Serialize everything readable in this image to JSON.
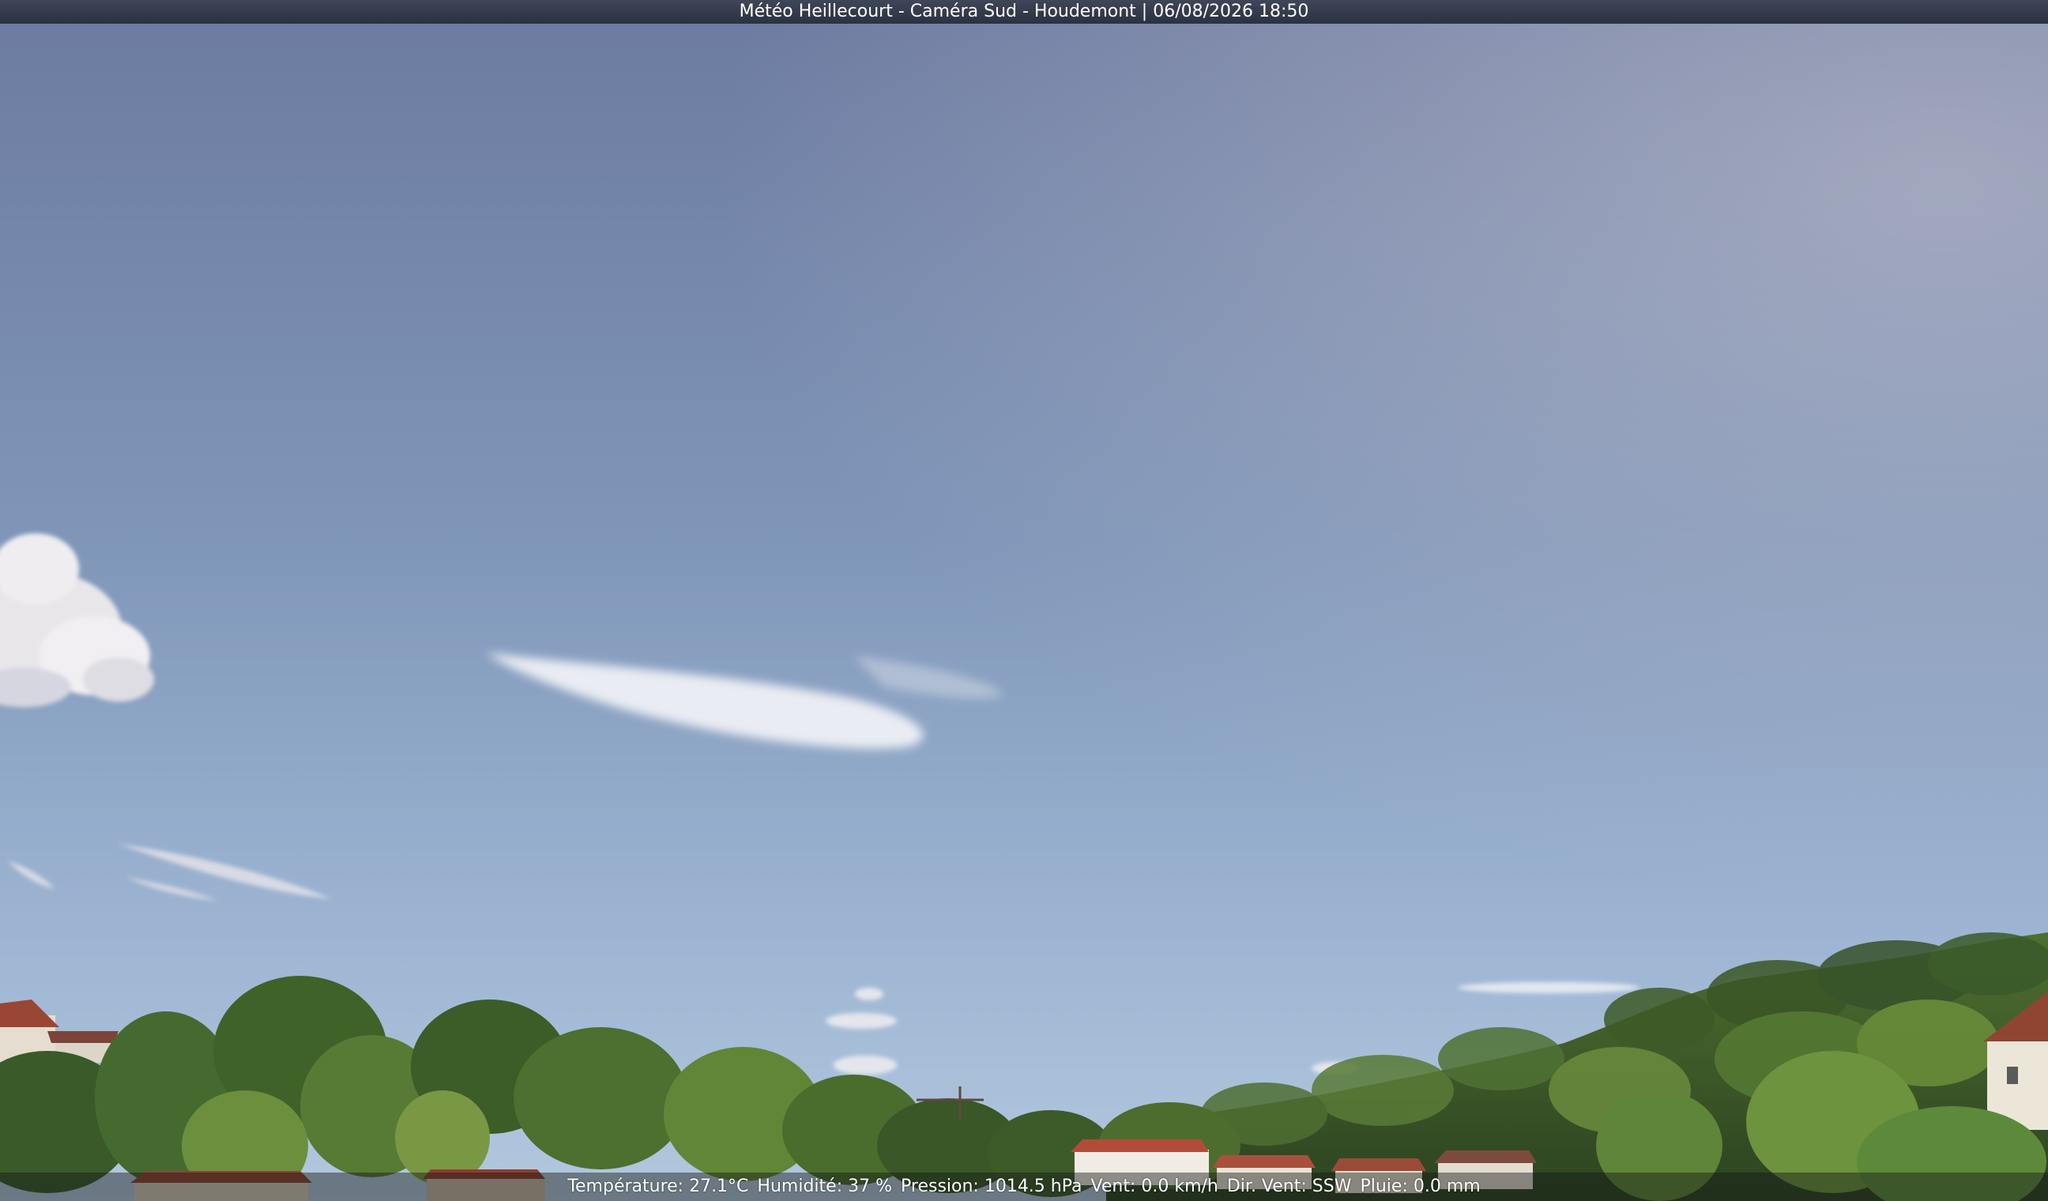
{
  "title_bar": {
    "text": "Météo Heillecourt - Caméra Sud - Houdemont | 06/08/2026 18:50"
  },
  "weather_bar": {
    "temperature": "Température: 27.1°C",
    "humidity": "Humidité: 37 %",
    "pressure": "Pression: 1014.5 hPa",
    "wind": "Vent: 0.0 km/h",
    "wind_direction": "Dir. Vent: SSW",
    "rain": "Pluie: 0.0 mm"
  },
  "scene": {
    "sky_top": "#6f7ea3",
    "sky_bottom": "#a9c2dc",
    "foliage_dark": "#2f4a22",
    "foliage_light": "#6d8f3c",
    "roof_color": "#a3503a"
  }
}
